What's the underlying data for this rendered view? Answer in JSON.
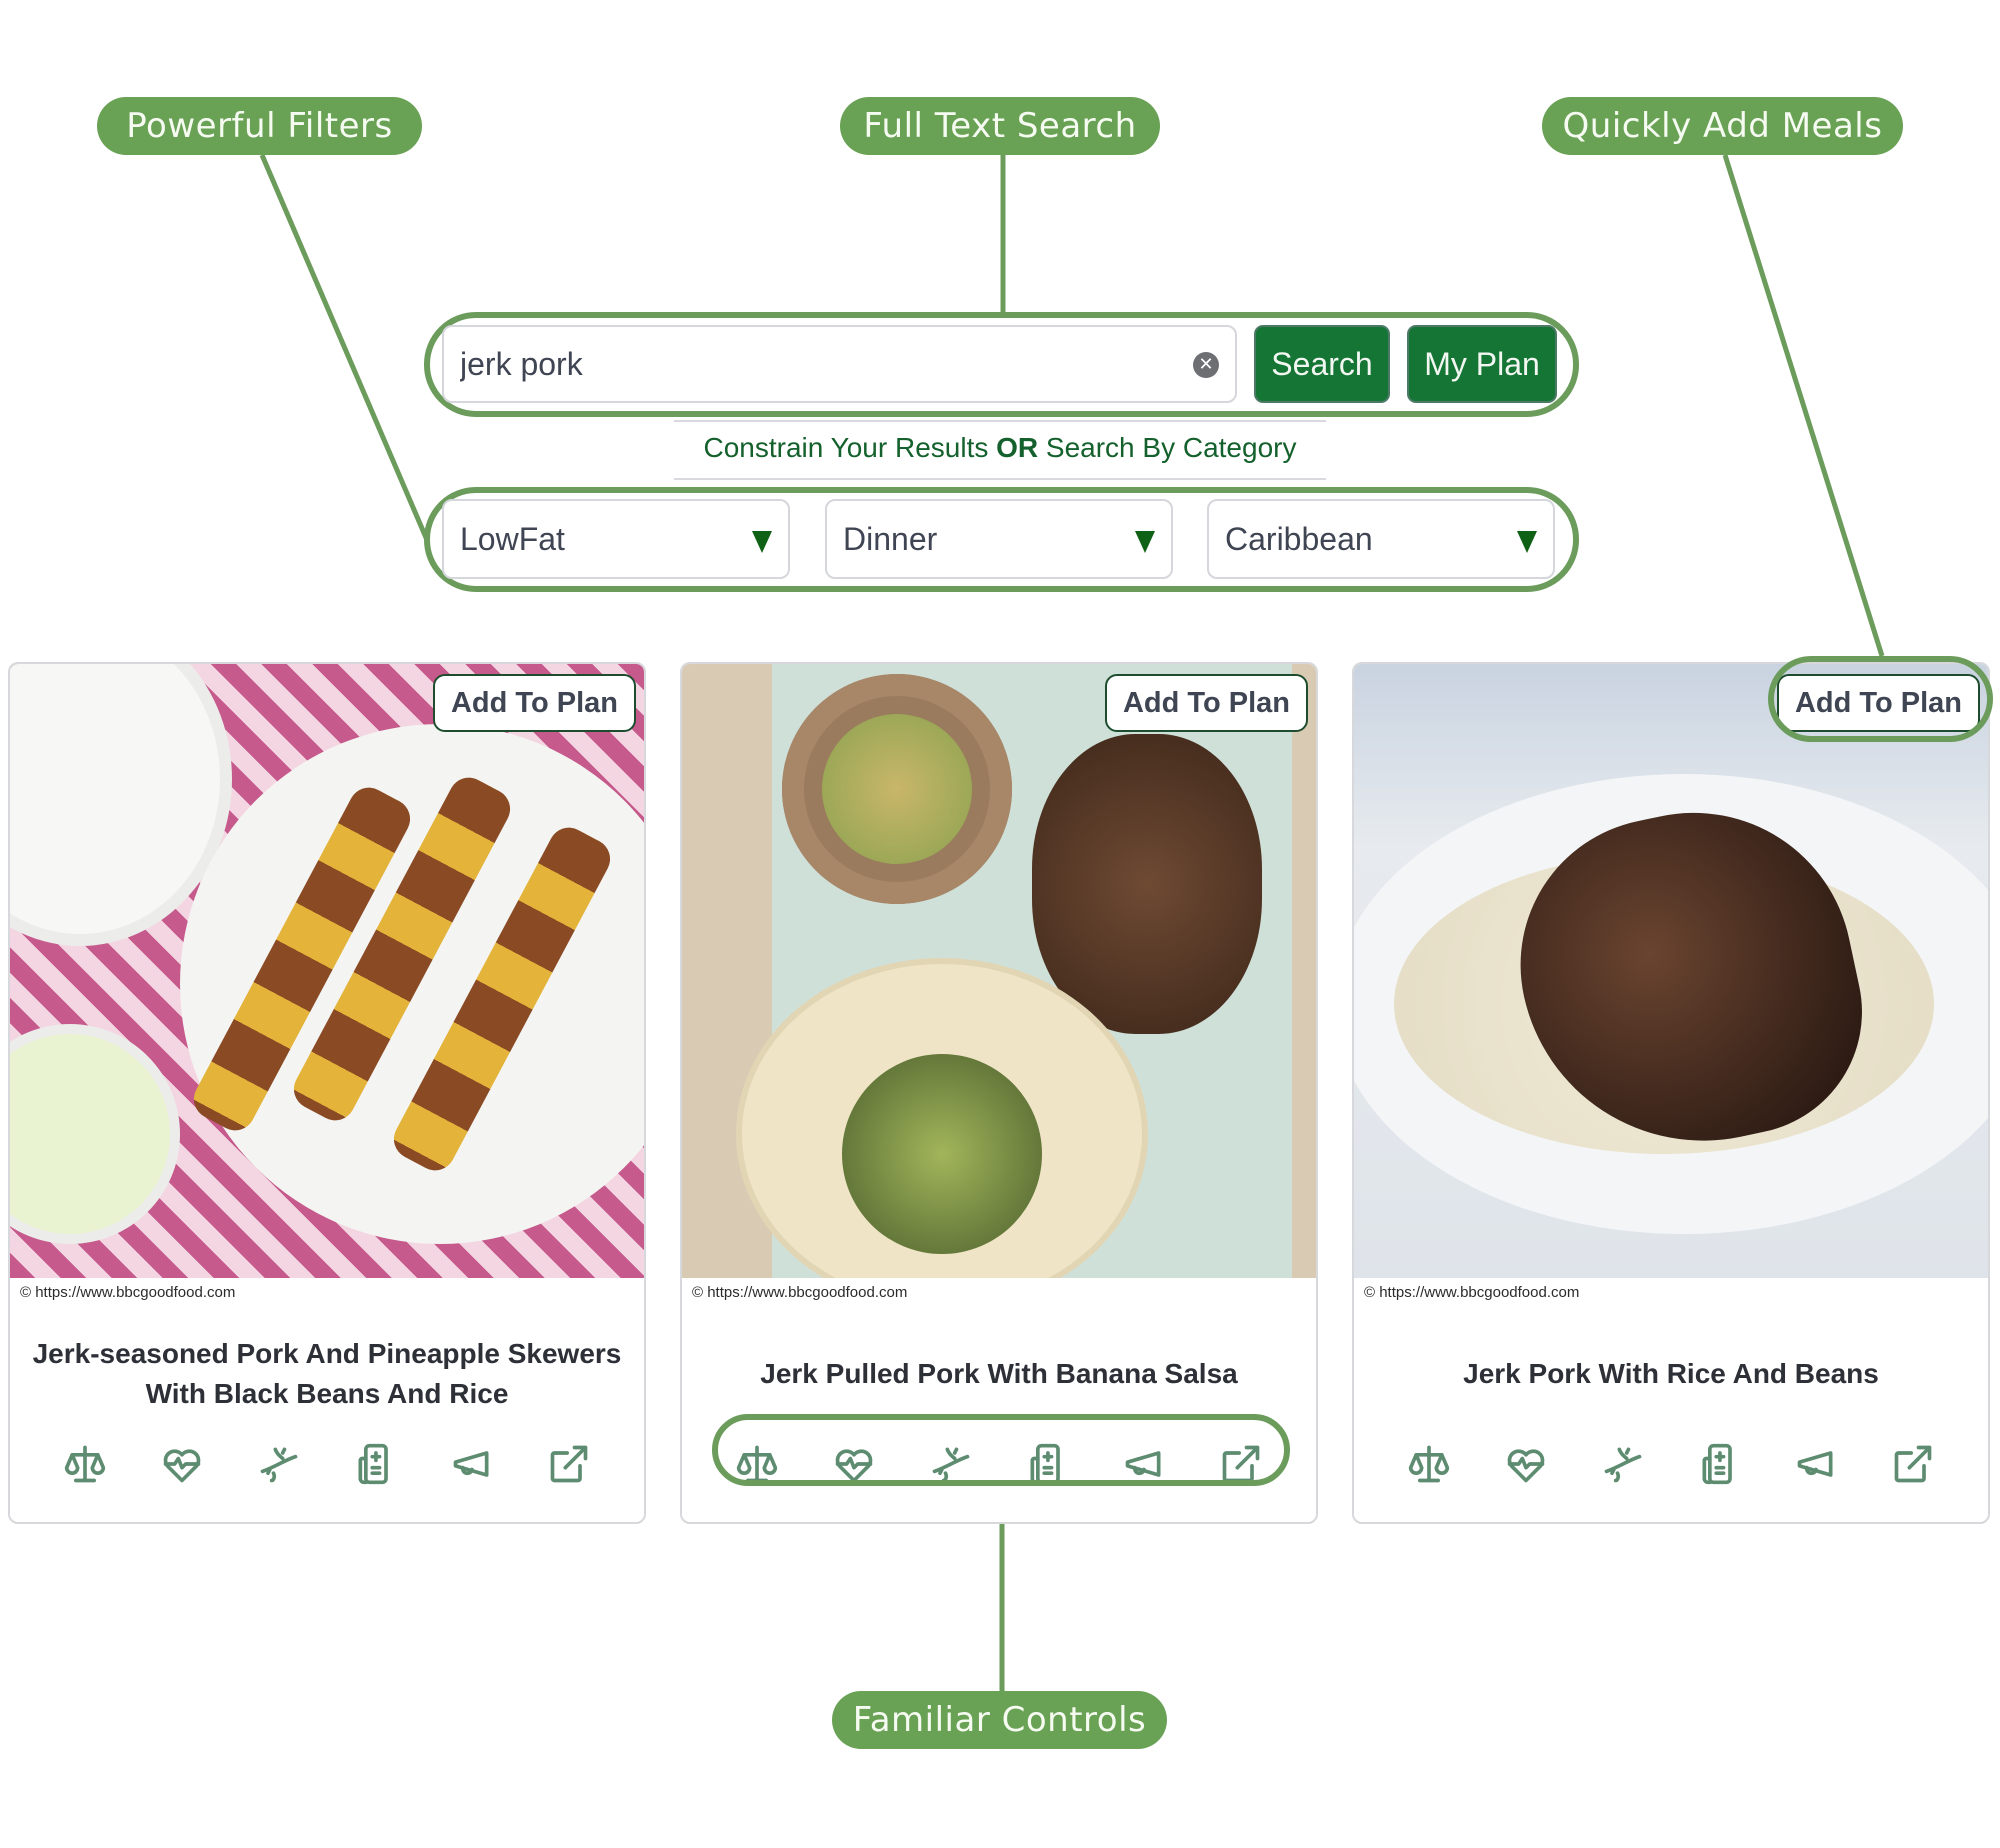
{
  "callouts": {
    "filters": "Powerful Filters",
    "search": "Full Text Search",
    "add_meals": "Quickly Add Meals",
    "controls": "Familiar Controls"
  },
  "search": {
    "value": "jerk pork",
    "placeholder": "",
    "clear_icon": "clear-circle-x-icon",
    "search_button": "Search",
    "my_plan_button": "My Plan"
  },
  "constrain": {
    "prefix": "Constrain Your Results ",
    "emphasis": "OR",
    "suffix": " Search By Category"
  },
  "filters": [
    {
      "selected": "LowFat"
    },
    {
      "selected": "Dinner"
    },
    {
      "selected": "Caribbean"
    }
  ],
  "colors": {
    "callout_green": "#69a155",
    "button_green": "#157535",
    "icon_green": "#5e8c71",
    "arrow_green": "#0e6115"
  },
  "cards": [
    {
      "add_label": "Add To Plan",
      "credit": "© https://www.bbcgoodfood.com",
      "title": "Jerk-seasoned Pork And Pineapple Skewers With Black Beans And Rice"
    },
    {
      "add_label": "Add To Plan",
      "credit": "© https://www.bbcgoodfood.com",
      "title": "Jerk Pulled Pork With Banana Salsa"
    },
    {
      "add_label": "Add To Plan",
      "credit": "© https://www.bbcgoodfood.com",
      "title": "Jerk Pork With Rice And Beans"
    }
  ],
  "card_icons": [
    "balance-scale-icon",
    "heart-pulse-icon",
    "dna-icon",
    "medical-report-icon",
    "megaphone-icon",
    "external-link-icon"
  ]
}
